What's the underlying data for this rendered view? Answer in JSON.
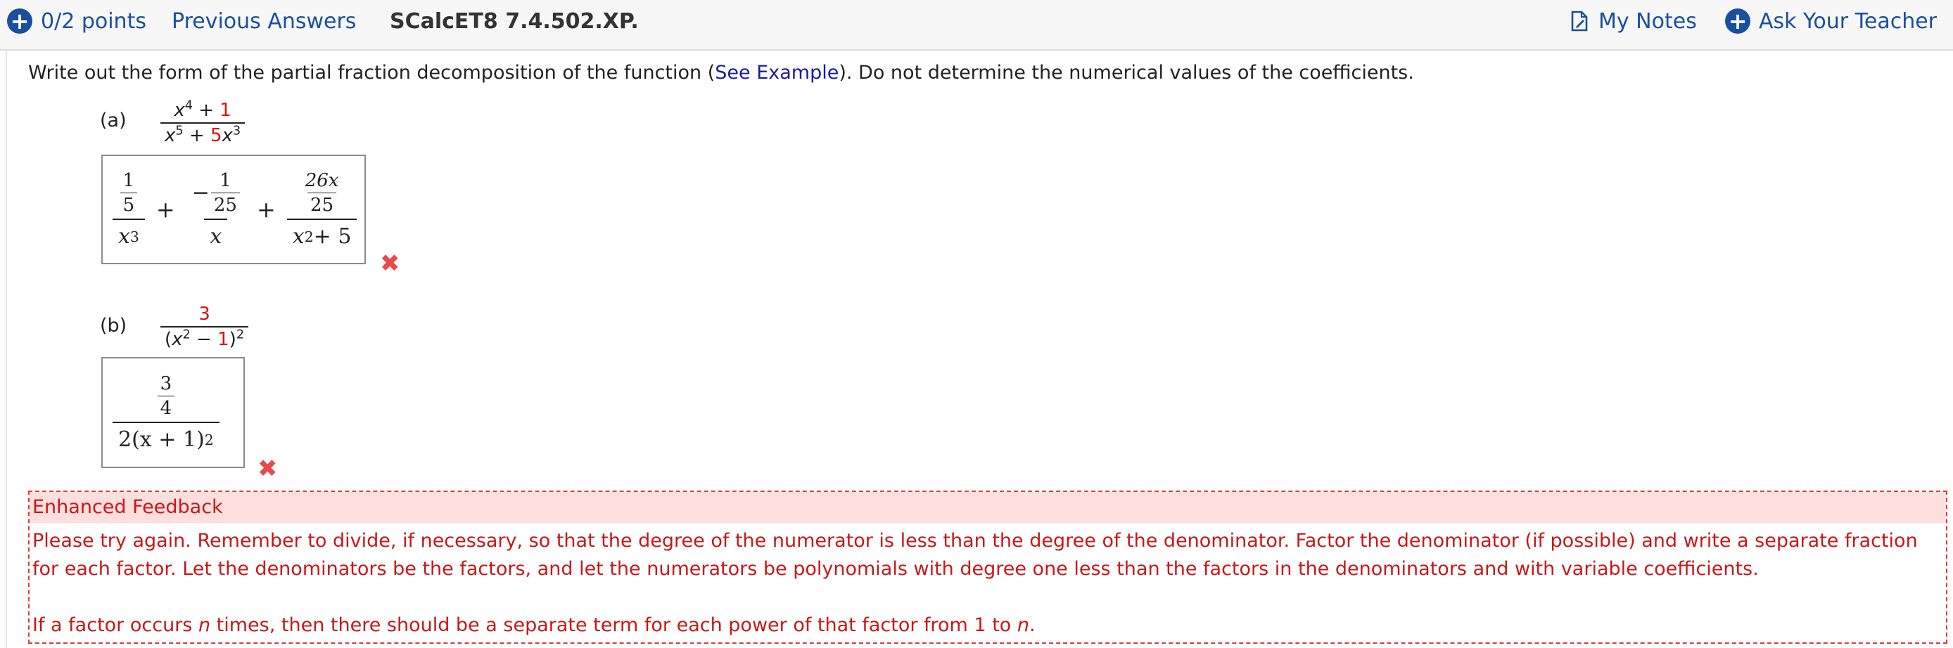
{
  "header": {
    "points": "0/2 points",
    "previous_answers": "Previous Answers",
    "problem_id": "SCalcET8 7.4.502.XP.",
    "my_notes": "My Notes",
    "ask_teacher": "Ask Your Teacher"
  },
  "prompt": {
    "before": "Write out the form of the partial fraction decomposition of the function (",
    "link": "See Example",
    "after": "). Do not determine the numerical values of the coefficients."
  },
  "part_a": {
    "label": "(a)",
    "question": {
      "num_var": "x",
      "num_exp": "4",
      "num_plus": " + ",
      "num_const": "1",
      "den_var1": "x",
      "den_exp1": "5",
      "den_plus": " + ",
      "den_coef": "5",
      "den_var2": "x",
      "den_exp2": "3"
    },
    "answer": {
      "t1_num_n": "1",
      "t1_num_d": "5",
      "t1_den_var": "x",
      "t1_den_exp": "3",
      "op1": "+",
      "t2_neg": "−",
      "t2_num_n": "1",
      "t2_num_d": "25",
      "t2_den": "x",
      "op2": "+",
      "t3_num_n": "26x",
      "t3_num_d": "25",
      "t3_den_var": "x",
      "t3_den_exp": "2",
      "t3_den_rest": " + 5"
    }
  },
  "part_b": {
    "label": "(b)",
    "question": {
      "num": "3",
      "den_open": "(",
      "den_var": "x",
      "den_exp": "2",
      "den_minus": " − ",
      "den_const": "1",
      "den_close": ")",
      "den_outer_exp": "2"
    },
    "answer": {
      "num_n": "3",
      "num_d": "4",
      "den_pre": "2(x + 1)",
      "den_exp": "2"
    }
  },
  "incorrect_mark": "✖",
  "feedback": {
    "title": "Enhanced Feedback",
    "para1": "Please try again. Remember to divide, if necessary, so that the degree of the numerator is less than the degree of the denominator. Factor the denominator (if possible) and write a separate fraction for each factor. Let the denominators be the factors, and let the numerators be polynomials with degree one less than the factors in the denominators and with variable coefficients.",
    "para2_before": "If a factor occurs ",
    "para2_n1": "n",
    "para2_mid": " times, then there should be a separate term for each power of that factor from 1 to ",
    "para2_n2": "n",
    "para2_end": "."
  },
  "colors": {
    "link_blue": "#1a4fa0",
    "feedback_red": "#c81818",
    "feedback_bg": "#ffdede",
    "mark_red": "#e84a4a"
  }
}
